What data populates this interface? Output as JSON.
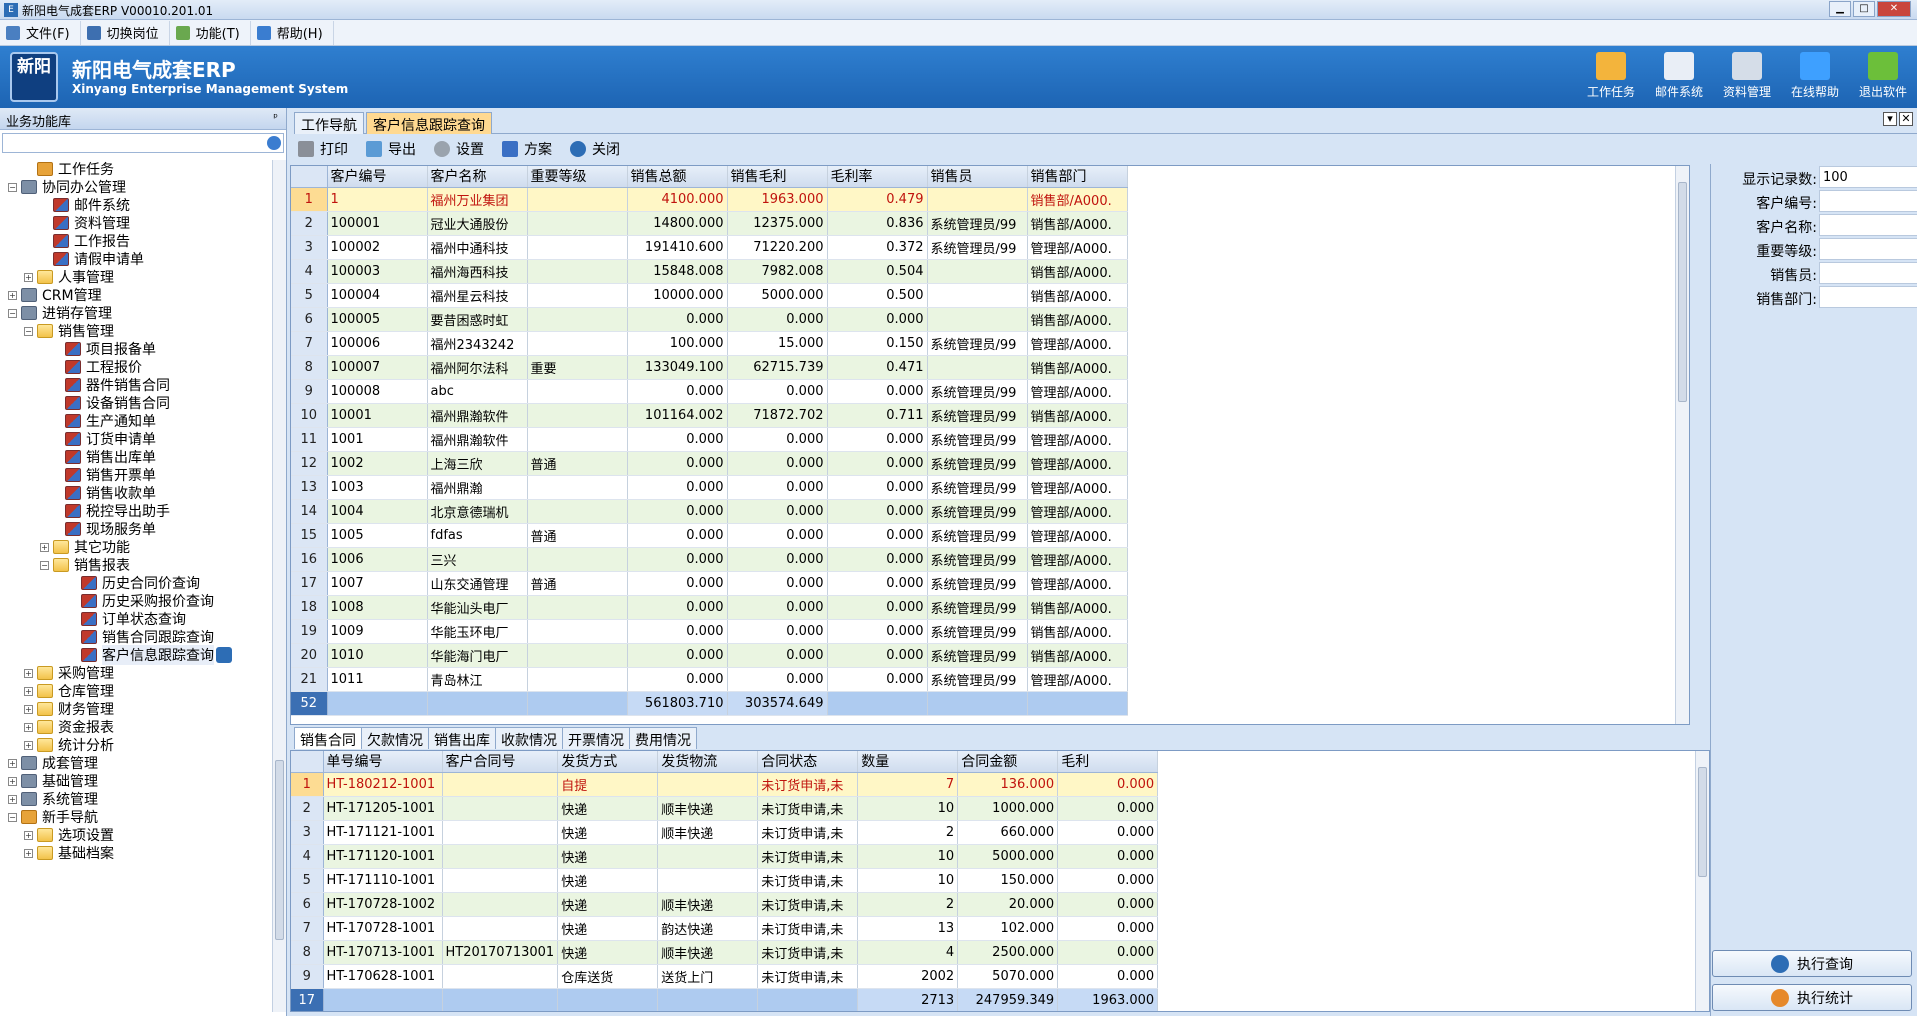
{
  "window": {
    "title": "新阳电气成套ERP V00010.201.01"
  },
  "menu": [
    {
      "label": "文件(F)",
      "color": "#4a7fc1"
    },
    {
      "label": "切换岗位",
      "color": "#3d6fb0"
    },
    {
      "label": "功能(T)",
      "color": "#6aa84f"
    },
    {
      "label": "帮助(H)",
      "color": "#3a7dd0"
    }
  ],
  "header": {
    "logo_text": "新阳",
    "brand_cn": "新阳电气成套ERP",
    "brand_en": "Xinyang Enterprise Management System",
    "tools": [
      {
        "label": "工作任务",
        "icon": "person-task-icon"
      },
      {
        "label": "邮件系统",
        "icon": "mail-icon"
      },
      {
        "label": "资料管理",
        "icon": "document-icon"
      },
      {
        "label": "在线帮助",
        "icon": "info-icon"
      },
      {
        "label": "退出软件",
        "icon": "exit-icon"
      }
    ]
  },
  "sidebar": {
    "title": "业务功能库",
    "tree": [
      {
        "label": "工作任务",
        "level": 1,
        "icon": "task",
        "exp": ""
      },
      {
        "label": "协同办公管理",
        "level": 0,
        "icon": "sys",
        "exp": "−"
      },
      {
        "label": "邮件系统",
        "level": 2,
        "icon": "doc",
        "exp": ""
      },
      {
        "label": "资料管理",
        "level": 2,
        "icon": "doc",
        "exp": ""
      },
      {
        "label": "工作报告",
        "level": 2,
        "icon": "doc",
        "exp": ""
      },
      {
        "label": "请假申请单",
        "level": 2,
        "icon": "doc",
        "exp": ""
      },
      {
        "label": "人事管理",
        "level": 1,
        "icon": "folder",
        "exp": "+"
      },
      {
        "label": "CRM管理",
        "level": 0,
        "icon": "sys",
        "exp": "+"
      },
      {
        "label": "进销存管理",
        "level": 0,
        "icon": "sys",
        "exp": "−"
      },
      {
        "label": "销售管理",
        "level": 1,
        "icon": "folder",
        "exp": "−"
      },
      {
        "label": "项目报备单",
        "level": 3,
        "icon": "doc",
        "exp": ""
      },
      {
        "label": "工程报价",
        "level": 3,
        "icon": "doc",
        "exp": ""
      },
      {
        "label": "器件销售合同",
        "level": 3,
        "icon": "doc",
        "exp": ""
      },
      {
        "label": "设备销售合同",
        "level": 3,
        "icon": "doc",
        "exp": ""
      },
      {
        "label": "生产通知单",
        "level": 3,
        "icon": "doc",
        "exp": ""
      },
      {
        "label": "订货申请单",
        "level": 3,
        "icon": "doc",
        "exp": ""
      },
      {
        "label": "销售出库单",
        "level": 3,
        "icon": "doc",
        "exp": ""
      },
      {
        "label": "销售开票单",
        "level": 3,
        "icon": "doc",
        "exp": ""
      },
      {
        "label": "销售收款单",
        "level": 3,
        "icon": "doc",
        "exp": ""
      },
      {
        "label": "税控导出助手",
        "level": 3,
        "icon": "doc",
        "exp": ""
      },
      {
        "label": "现场服务单",
        "level": 3,
        "icon": "doc",
        "exp": ""
      },
      {
        "label": "其它功能",
        "level": 2,
        "icon": "folder",
        "exp": "+"
      },
      {
        "label": "销售报表",
        "level": 2,
        "icon": "folder",
        "exp": "−"
      },
      {
        "label": "历史合同价查询",
        "level": 4,
        "icon": "doc",
        "exp": ""
      },
      {
        "label": "历史采购报价查询",
        "level": 4,
        "icon": "doc",
        "exp": ""
      },
      {
        "label": "订单状态查询",
        "level": 4,
        "icon": "doc",
        "exp": ""
      },
      {
        "label": "销售合同跟踪查询",
        "level": 4,
        "icon": "doc",
        "exp": ""
      },
      {
        "label": "客户信息跟踪查询",
        "level": 4,
        "icon": "doc",
        "exp": "",
        "selected": true
      },
      {
        "label": "采购管理",
        "level": 1,
        "icon": "folder",
        "exp": "+"
      },
      {
        "label": "仓库管理",
        "level": 1,
        "icon": "folder",
        "exp": "+"
      },
      {
        "label": "财务管理",
        "level": 1,
        "icon": "folder",
        "exp": "+"
      },
      {
        "label": "资金报表",
        "level": 1,
        "icon": "folder",
        "exp": "+"
      },
      {
        "label": "统计分析",
        "level": 1,
        "icon": "folder",
        "exp": "+"
      },
      {
        "label": "成套管理",
        "level": 0,
        "icon": "sys",
        "exp": "+"
      },
      {
        "label": "基础管理",
        "level": 0,
        "icon": "sys",
        "exp": "+"
      },
      {
        "label": "系统管理",
        "level": 0,
        "icon": "sys",
        "exp": "+"
      },
      {
        "label": "新手导航",
        "level": 0,
        "icon": "task",
        "exp": "−"
      },
      {
        "label": "选项设置",
        "level": 1,
        "icon": "folder",
        "exp": "+"
      },
      {
        "label": "基础档案",
        "level": 1,
        "icon": "folder",
        "exp": "+"
      }
    ]
  },
  "tabs": [
    {
      "label": "工作导航",
      "active": false
    },
    {
      "label": "客户信息跟踪查询",
      "active": true
    }
  ],
  "toolbar": [
    {
      "label": "打印",
      "icon": "print-icon",
      "color": "#8a8f98"
    },
    {
      "label": "导出",
      "icon": "export-icon",
      "color": "#5b9bd5"
    },
    {
      "label": "设置",
      "icon": "settings-icon",
      "color": "#9aa3ad"
    },
    {
      "label": "方案",
      "icon": "flag-icon",
      "color": "#3a6fc4"
    },
    {
      "label": "关闭",
      "icon": "close-icon",
      "color": "#2d6db5"
    }
  ],
  "customer_grid": {
    "columns": [
      "客户编号",
      "客户名称",
      "重要等级",
      "销售总额",
      "销售毛利",
      "毛利率",
      "销售员",
      "销售部门"
    ],
    "rows": [
      [
        "1",
        "福州万业集团",
        "",
        "4100.000",
        "1963.000",
        "0.479",
        "",
        "销售部/A000."
      ],
      [
        "100001",
        "冠业大通股份",
        "",
        "14800.000",
        "12375.000",
        "0.836",
        "系统管理员/99",
        "销售部/A000."
      ],
      [
        "100002",
        "福州中通科技",
        "",
        "191410.600",
        "71220.200",
        "0.372",
        "系统管理员/99",
        "管理部/A000."
      ],
      [
        "100003",
        "福州海西科技",
        "",
        "15848.008",
        "7982.008",
        "0.504",
        "",
        "销售部/A000."
      ],
      [
        "100004",
        "福州星云科技",
        "",
        "10000.000",
        "5000.000",
        "0.500",
        "",
        "销售部/A000."
      ],
      [
        "100005",
        "要昔困惑时虹",
        "",
        "0.000",
        "0.000",
        "0.000",
        "",
        "销售部/A000."
      ],
      [
        "100006",
        "福州2343242",
        "",
        "100.000",
        "15.000",
        "0.150",
        "系统管理员/99",
        "管理部/A000."
      ],
      [
        "100007",
        "福州阿尔法科",
        "重要",
        "133049.100",
        "62715.739",
        "0.471",
        "",
        "销售部/A000."
      ],
      [
        "100008",
        "abc",
        "",
        "0.000",
        "0.000",
        "0.000",
        "系统管理员/99",
        "管理部/A000."
      ],
      [
        "10001",
        "福州鼎瀚软件",
        "",
        "101164.002",
        "71872.702",
        "0.711",
        "系统管理员/99",
        "销售部/A000."
      ],
      [
        "1001",
        "福州鼎瀚软件",
        "",
        "0.000",
        "0.000",
        "0.000",
        "系统管理员/99",
        "管理部/A000."
      ],
      [
        "1002",
        "上海三欣",
        "普通",
        "0.000",
        "0.000",
        "0.000",
        "系统管理员/99",
        "管理部/A000."
      ],
      [
        "1003",
        "福州鼎瀚",
        "",
        "0.000",
        "0.000",
        "0.000",
        "系统管理员/99",
        "管理部/A000."
      ],
      [
        "1004",
        "北京意德瑞机",
        "",
        "0.000",
        "0.000",
        "0.000",
        "系统管理员/99",
        "管理部/A000."
      ],
      [
        "1005",
        "fdfas",
        "普通",
        "0.000",
        "0.000",
        "0.000",
        "系统管理员/99",
        "管理部/A000."
      ],
      [
        "1006",
        "三兴",
        "",
        "0.000",
        "0.000",
        "0.000",
        "系统管理员/99",
        "管理部/A000."
      ],
      [
        "1007",
        "山东交通管理",
        "普通",
        "0.000",
        "0.000",
        "0.000",
        "系统管理员/99",
        "管理部/A000."
      ],
      [
        "1008",
        "华能汕头电厂",
        "",
        "0.000",
        "0.000",
        "0.000",
        "系统管理员/99",
        "销售部/A000."
      ],
      [
        "1009",
        "华能玉环电厂",
        "",
        "0.000",
        "0.000",
        "0.000",
        "系统管理员/99",
        "销售部/A000."
      ],
      [
        "1010",
        "华能海门电厂",
        "",
        "0.000",
        "0.000",
        "0.000",
        "系统管理员/99",
        "销售部/A000."
      ],
      [
        "1011",
        "青岛林江",
        "",
        "0.000",
        "0.000",
        "0.000",
        "系统管理员/99",
        "管理部/A000."
      ]
    ],
    "footer": {
      "count": "52",
      "sales_total": "561803.710",
      "profit_total": "303574.649"
    }
  },
  "subtabs": [
    "销售合同",
    "欠款情况",
    "销售出库",
    "收款情况",
    "开票情况",
    "费用情况"
  ],
  "contract_grid": {
    "columns": [
      "单号编号",
      "客户合同号",
      "发货方式",
      "发货物流",
      "合同状态",
      "数量",
      "合同金额",
      "毛利"
    ],
    "rows": [
      [
        "HT-180212-1001",
        "",
        "自提",
        "",
        "未订货申请,未",
        "7",
        "136.000",
        "0.000"
      ],
      [
        "HT-171205-1001",
        "",
        "快递",
        "顺丰快递",
        "未订货申请,未",
        "10",
        "1000.000",
        "0.000"
      ],
      [
        "HT-171121-1001",
        "",
        "快递",
        "顺丰快递",
        "未订货申请,未",
        "2",
        "660.000",
        "0.000"
      ],
      [
        "HT-171120-1001",
        "",
        "快递",
        "",
        "未订货申请,未",
        "10",
        "5000.000",
        "0.000"
      ],
      [
        "HT-171110-1001",
        "",
        "快递",
        "",
        "未订货申请,未",
        "10",
        "150.000",
        "0.000"
      ],
      [
        "HT-170728-1002",
        "",
        "快递",
        "顺丰快递",
        "未订货申请,未",
        "2",
        "20.000",
        "0.000"
      ],
      [
        "HT-170728-1001",
        "",
        "快递",
        "韵达快递",
        "未订货申请,未",
        "13",
        "102.000",
        "0.000"
      ],
      [
        "HT-170713-1001",
        "HT20170713001",
        "快递",
        "顺丰快递",
        "未订货申请,未",
        "4",
        "2500.000",
        "0.000"
      ],
      [
        "HT-170628-1001",
        "",
        "仓库送货",
        "送货上门",
        "未订货申请,未",
        "2002",
        "5070.000",
        "0.000"
      ]
    ],
    "footer": {
      "count": "17",
      "qty_total": "2713",
      "amount_total": "247959.349",
      "profit_total": "1963.000"
    }
  },
  "filters": [
    {
      "label": "显示记录数:",
      "value": "100"
    },
    {
      "label": "客户编号:",
      "value": ""
    },
    {
      "label": "客户名称:",
      "value": ""
    },
    {
      "label": "重要等级:",
      "value": ""
    },
    {
      "label": "销售员:",
      "value": ""
    },
    {
      "label": "销售部门:",
      "value": ""
    }
  ],
  "actions": {
    "query": "执行查询",
    "stats": "执行统计"
  }
}
